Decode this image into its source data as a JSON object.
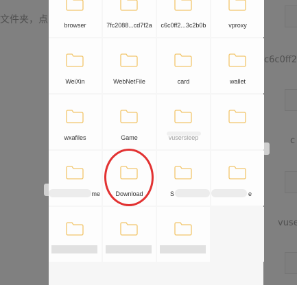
{
  "background": {
    "left_text": "文件夹，点",
    "right_text_1": "c6c0ff2",
    "right_text_2": "c",
    "right_text_3": "vuse"
  },
  "folders": [
    {
      "label": "browser"
    },
    {
      "label": "7fc2088...cd7f2a"
    },
    {
      "label": "c6c0ff2...3c2b0b"
    },
    {
      "label": "vproxy"
    },
    {
      "label": "WeiXin"
    },
    {
      "label": "WebNetFile"
    },
    {
      "label": "card"
    },
    {
      "label": "wallet"
    },
    {
      "label": "wxafiles"
    },
    {
      "label": "Game"
    },
    {
      "label": "vusersleep"
    },
    {
      "label": ""
    },
    {
      "label": "me"
    },
    {
      "label": "Download"
    },
    {
      "label": "S"
    },
    {
      "label": "e"
    },
    {
      "label": ""
    },
    {
      "label": ""
    },
    {
      "label": ""
    },
    {
      "label": ""
    }
  ],
  "colors": {
    "folder_outline": "#f2c66b",
    "highlight_ring": "#e23232"
  },
  "icons": {
    "folder": "folder-icon"
  }
}
